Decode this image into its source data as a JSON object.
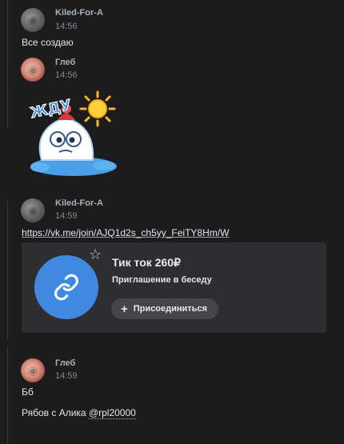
{
  "messages": [
    {
      "author": "Kiled-For-A",
      "time": "14:56",
      "text": "Все создаю"
    },
    {
      "author": "Глеб",
      "time": "14:56",
      "sticker": {
        "word": "ЖДУ",
        "icon": "sticker-snowman-waiting"
      }
    },
    {
      "author": "Kiled-For-A",
      "time": "14:59",
      "link": "https://vk.me/join/AJQ1d2s_ch5yy_FeiTY8Hm/W",
      "card": {
        "title": "Тик ток 260₽",
        "subtitle": "Приглашение в беседу",
        "join_label": "Присоединиться",
        "icon": "chain-link-icon",
        "accent": "#3f8ae0"
      }
    },
    {
      "author": "Глеб",
      "time": "14:59",
      "line1": "Бб",
      "line2_prefix": "Рябов с Алика ",
      "mention": "@rpl20000"
    }
  ],
  "colors": {
    "background": "#1c1c1d",
    "card_background": "#2e2e30",
    "name_color": "#a9b2bd",
    "time_color": "#838a92"
  }
}
